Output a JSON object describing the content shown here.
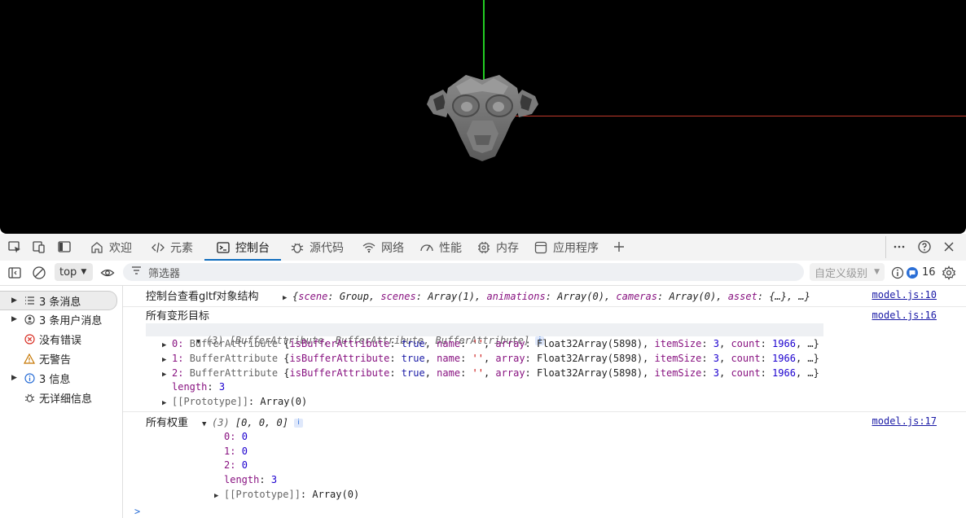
{
  "tabs": [
    {
      "label": "欢迎",
      "icon": "home-icon"
    },
    {
      "label": "元素",
      "icon": "code-icon"
    },
    {
      "label": "控制台",
      "icon": "console-icon",
      "active": true
    },
    {
      "label": "源代码",
      "icon": "bug-icon"
    },
    {
      "label": "网络",
      "icon": "wifi-icon"
    },
    {
      "label": "性能",
      "icon": "gauge-icon"
    },
    {
      "label": "内存",
      "icon": "chip-icon"
    },
    {
      "label": "应用程序",
      "icon": "app-icon"
    }
  ],
  "toolbar": {
    "context": "top",
    "filter_placeholder": "筛选器",
    "level": "自定义级别",
    "badge_count": "16"
  },
  "sidebar": {
    "items": [
      {
        "label": "3 条消息",
        "icon": "list-icon",
        "expandable": true,
        "selected": true
      },
      {
        "label": "3 条用户消息",
        "icon": "user-icon",
        "expandable": true
      },
      {
        "label": "没有错误",
        "icon": "error-icon",
        "expandable": false
      },
      {
        "label": "无警告",
        "icon": "warning-icon",
        "expandable": false
      },
      {
        "label": "3 信息",
        "icon": "info-icon",
        "expandable": true
      },
      {
        "label": "无详细信息",
        "icon": "verbose-icon",
        "expandable": false
      }
    ]
  },
  "console": {
    "msg1": {
      "label": "控制台查看gltf对象结构",
      "source": "model.js:10",
      "p1k": "scene",
      "p1v": "Group",
      "p2k": "scenes",
      "p2v": "Array(1)",
      "p3k": "animations",
      "p3v": "Array(0)",
      "p4k": "cameras",
      "p4v": "Array(0)",
      "p5k": "asset",
      "p5v": "{…}",
      "tail": "…}"
    },
    "msg2": {
      "label": "所有变形目标",
      "source": "model.js:16",
      "header": "(3) [BufferAttribute, BufferAttribute, BufferAttribute]",
      "rows": [
        {
          "index": "0",
          "type": "BufferAttribute",
          "arraylen": "5898",
          "itemsize": "3",
          "count": "1966"
        },
        {
          "index": "1",
          "type": "BufferAttribute",
          "arraylen": "5898",
          "itemsize": "3",
          "count": "1966"
        },
        {
          "index": "2",
          "type": "BufferAttribute",
          "arraylen": "5898",
          "itemsize": "3",
          "count": "1966"
        }
      ],
      "length_key": "length",
      "length_val": "3",
      "proto": "[[Prototype]]",
      "proto_val": "Array(0)"
    },
    "msg3": {
      "label": "所有权重",
      "source": "model.js:17",
      "header_count": "(3)",
      "header_vals": "[0, 0, 0]",
      "rows": [
        {
          "key": "0",
          "val": "0"
        },
        {
          "key": "1",
          "val": "0"
        },
        {
          "key": "2",
          "val": "0"
        }
      ],
      "length_key": "length",
      "length_val": "3",
      "proto": "[[Prototype]]",
      "proto_val": "Array(0)"
    }
  }
}
